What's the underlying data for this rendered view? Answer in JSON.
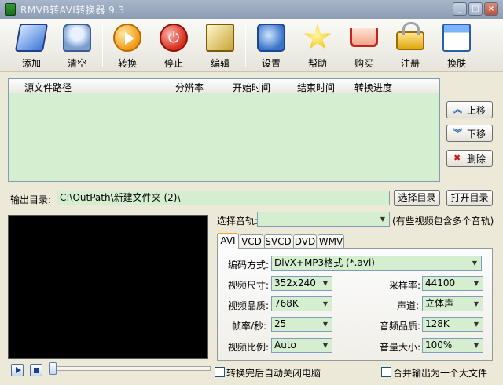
{
  "window": {
    "title": "RMVB转AVI转换器 9.3",
    "controls": [
      "_",
      "□",
      "×"
    ]
  },
  "toolbar": {
    "items": [
      {
        "label": "添加",
        "icon": "add-folder-icon"
      },
      {
        "label": "清空",
        "icon": "trash-icon"
      },
      {
        "label": "转换",
        "icon": "play-icon"
      },
      {
        "label": "停止",
        "icon": "power-icon"
      },
      {
        "label": "编辑",
        "icon": "edit-icon"
      },
      {
        "label": "设置",
        "icon": "settings-icon"
      },
      {
        "label": "帮助",
        "icon": "star-icon"
      },
      {
        "label": "购买",
        "icon": "cart-icon"
      },
      {
        "label": "注册",
        "icon": "lock-icon"
      },
      {
        "label": "换肤",
        "icon": "window-icon"
      }
    ]
  },
  "file_list": {
    "columns": [
      "源文件路径",
      "分辨率",
      "开始时间",
      "结束时间",
      "转换进度"
    ],
    "rows": []
  },
  "side_buttons": {
    "up": "上移",
    "down": "下移",
    "delete": "删除"
  },
  "output": {
    "label": "输出目录:",
    "path": "C:\\OutPath\\新建文件夹 (2)\\",
    "choose_btn": "选择目录",
    "open_btn": "打开目录"
  },
  "track": {
    "label": "选择音轨:",
    "value": "",
    "hint": "(有些视频包含多个音轨)"
  },
  "tabs": [
    "AVI",
    "VCD",
    "SVCD",
    "DVD",
    "WMV"
  ],
  "active_tab": "AVI",
  "settings": {
    "encoding_label": "编码方式:",
    "encoding_value": "DivX+MP3格式 (*.avi)",
    "size_label": "视频尺寸:",
    "size_value": "352x240",
    "quality_label": "视频品质:",
    "quality_value": "768K",
    "fps_label": "帧率/秒:",
    "fps_value": "25",
    "ratio_label": "视频比例:",
    "ratio_value": "Auto",
    "samplerate_label": "采样率:",
    "samplerate_value": "44100",
    "channel_label": "声道:",
    "channel_value": "立体声",
    "audio_quality_label": "音频品质:",
    "audio_quality_value": "128K",
    "volume_label": "音量大小:",
    "volume_value": "100%"
  },
  "options": {
    "shutdown_label": "转换完后自动关闭电脑",
    "merge_label": "合并输出为一个大文件"
  }
}
